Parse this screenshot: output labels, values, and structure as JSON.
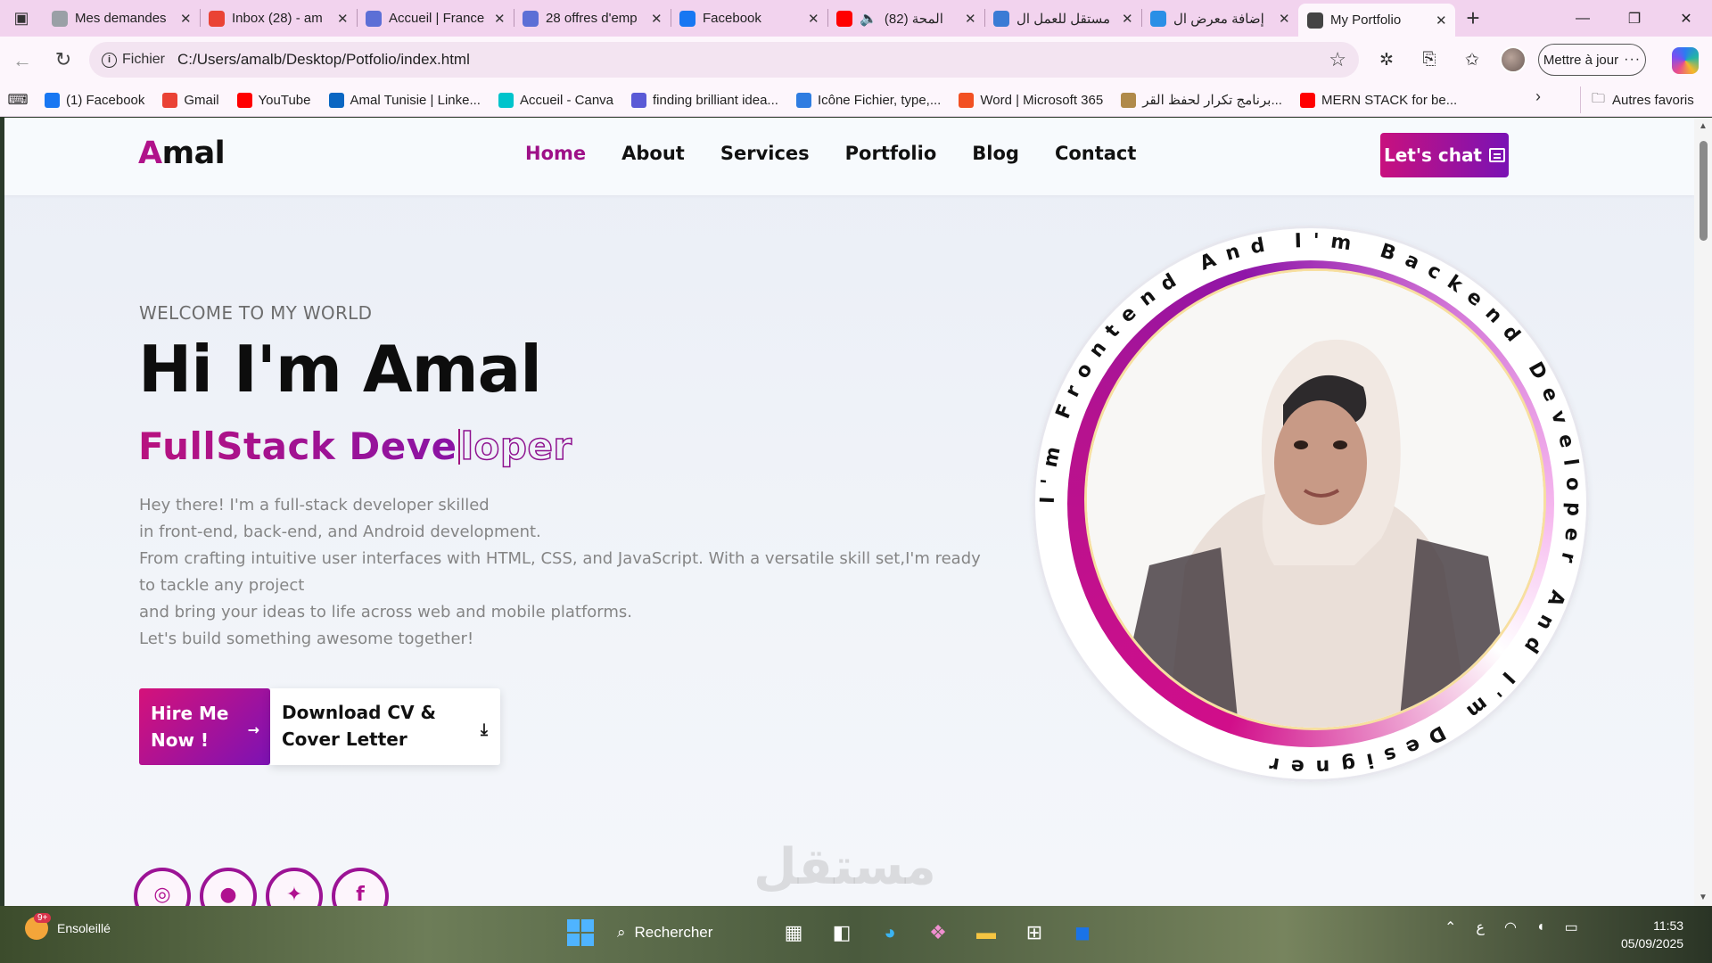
{
  "browser": {
    "tabs": [
      {
        "label": "Mes demandes",
        "icon": "loading-icon",
        "color": "#9aa0a6"
      },
      {
        "label": "Inbox (28) - am",
        "icon": "gmail-icon",
        "color": "#ea4335"
      },
      {
        "label": "Accueil | France",
        "icon": "francetravail-icon",
        "color": "#5c6fd6"
      },
      {
        "label": "28 offres d'emp",
        "icon": "francetravail-icon",
        "color": "#5c6fd6"
      },
      {
        "label": "Facebook",
        "icon": "facebook-icon",
        "color": "#1877f2"
      },
      {
        "label": "(82) المحة",
        "icon": "youtube-icon",
        "color": "#ff0000"
      },
      {
        "label": "مستقل للعمل ال",
        "icon": "search-icon",
        "color": "#3a7bd5"
      },
      {
        "label": "إضافة معرض ال",
        "icon": "mostaql-icon",
        "color": "#2a8fe6"
      },
      {
        "label": "My Portfolio",
        "icon": "globe-icon",
        "color": "#444444"
      }
    ],
    "omnibox": {
      "scheme_label": "Fichier",
      "url": "C:/Users/amalb/Desktop/Potfolio/index.html"
    },
    "update_button": "Mettre à jour",
    "bookmarks": [
      {
        "label": "(1) Facebook",
        "color": "#1877f2"
      },
      {
        "label": "Gmail",
        "color": "#ea4335"
      },
      {
        "label": "YouTube",
        "color": "#ff0000"
      },
      {
        "label": "Amal Tunisie | Linke...",
        "color": "#0a66c2"
      },
      {
        "label": "Accueil - Canva",
        "color": "#00c4cc"
      },
      {
        "label": "finding brilliant idea...",
        "color": "#5a5ad6"
      },
      {
        "label": "Icône Fichier, type,...",
        "color": "#2f7de1"
      },
      {
        "label": "Word | Microsoft 365",
        "color": "#f25022"
      },
      {
        "label": "برنامج تكرار لحفظ القر...",
        "color": "#b08a4a"
      },
      {
        "label": "MERN STACK for be...",
        "color": "#ff0000"
      }
    ],
    "other_bookmarks": "Autres favoris"
  },
  "site": {
    "logo_first": "A",
    "logo_rest": "mal",
    "nav": [
      "Home",
      "About",
      "Services",
      "Portfolio",
      "Blog",
      "Contact"
    ],
    "chat_button": "Let's chat",
    "kicker": "WELCOME TO MY WORLD",
    "title": "Hi I'm Amal",
    "role_typed": "FullStack Deve",
    "role_rest": "loper",
    "description": [
      "Hey there! I'm a full-stack developer skilled",
      "in front-end, back-end, and Android development.",
      "From crafting intuitive user interfaces with HTML, CSS, and JavaScript. With a versatile skill set,I'm ready to tackle any project",
      "and bring your ideas to life across web and mobile platforms.",
      "Let's build something awesome together!"
    ],
    "hire_button": [
      "Hire Me",
      "Now !"
    ],
    "cv_button": [
      "Download CV &",
      "Cover Letter"
    ],
    "ring_text": "I'm Frontend And I'm Backend Developer And I'm Designer",
    "watermark": "مستقل",
    "socials": [
      "instagram-icon",
      "github-icon",
      "twitter-icon",
      "facebook-icon"
    ],
    "accent_colors": {
      "pink": "#c8117e",
      "purple": "#7a12b4"
    }
  },
  "taskbar": {
    "weather_badge": "9+",
    "weather_label": "Ensoleillé",
    "search_label": "Rechercher",
    "tray_lang": "ع",
    "time": "11:53",
    "date": "05/09/2025"
  }
}
